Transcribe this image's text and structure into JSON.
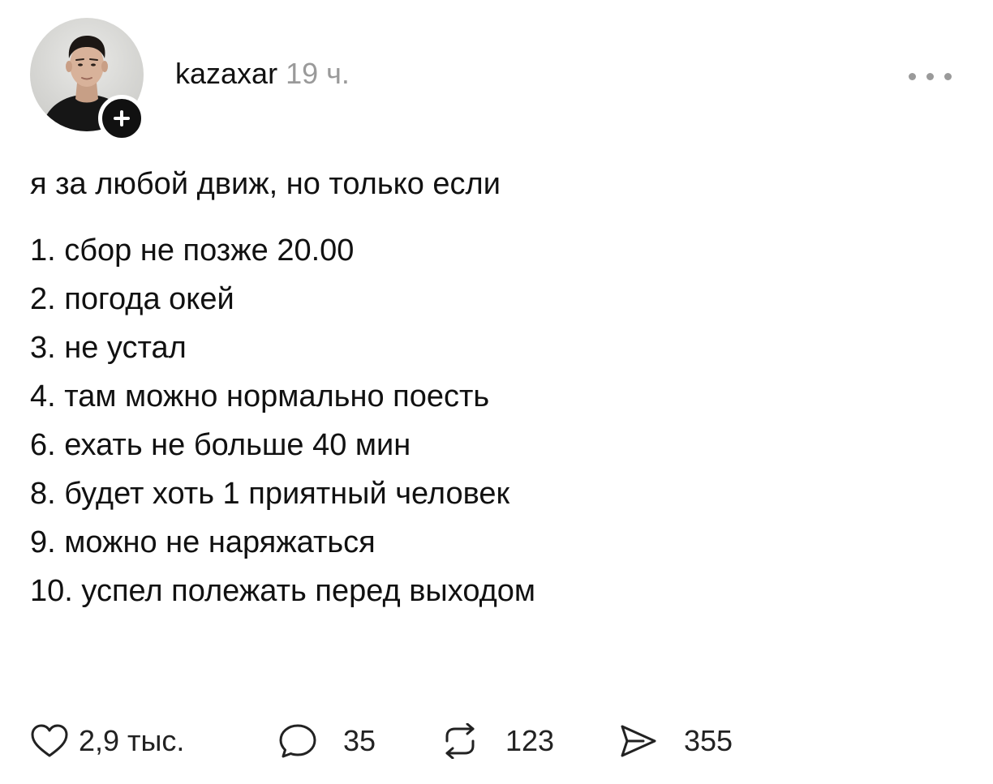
{
  "post": {
    "username": "kazaxar",
    "timestamp": "19 ч.",
    "intro": "я за любой движ, но только если",
    "list": [
      "1. сбор не позже 20.00",
      "2. погода окей",
      "3. не устал",
      "4. там можно нормально поесть",
      "6. ехать не больше 40 мин",
      "8. будет хоть 1 приятный человек",
      "9. можно не наряжаться",
      "10. успел полежать перед выходом"
    ]
  },
  "actions": {
    "like_count": "2,9 тыс.",
    "comment_count": "35",
    "repost_count": "123",
    "share_count": "355"
  },
  "icons": {
    "like": "heart-icon",
    "comment": "comment-bubble-icon",
    "repost": "repost-arrows-icon",
    "share": "send-arrow-icon",
    "follow": "plus-icon",
    "more": "more-dots-icon"
  },
  "colors": {
    "text": "#111111",
    "secondary_text": "#9a9a9a",
    "icon": "#222222"
  }
}
